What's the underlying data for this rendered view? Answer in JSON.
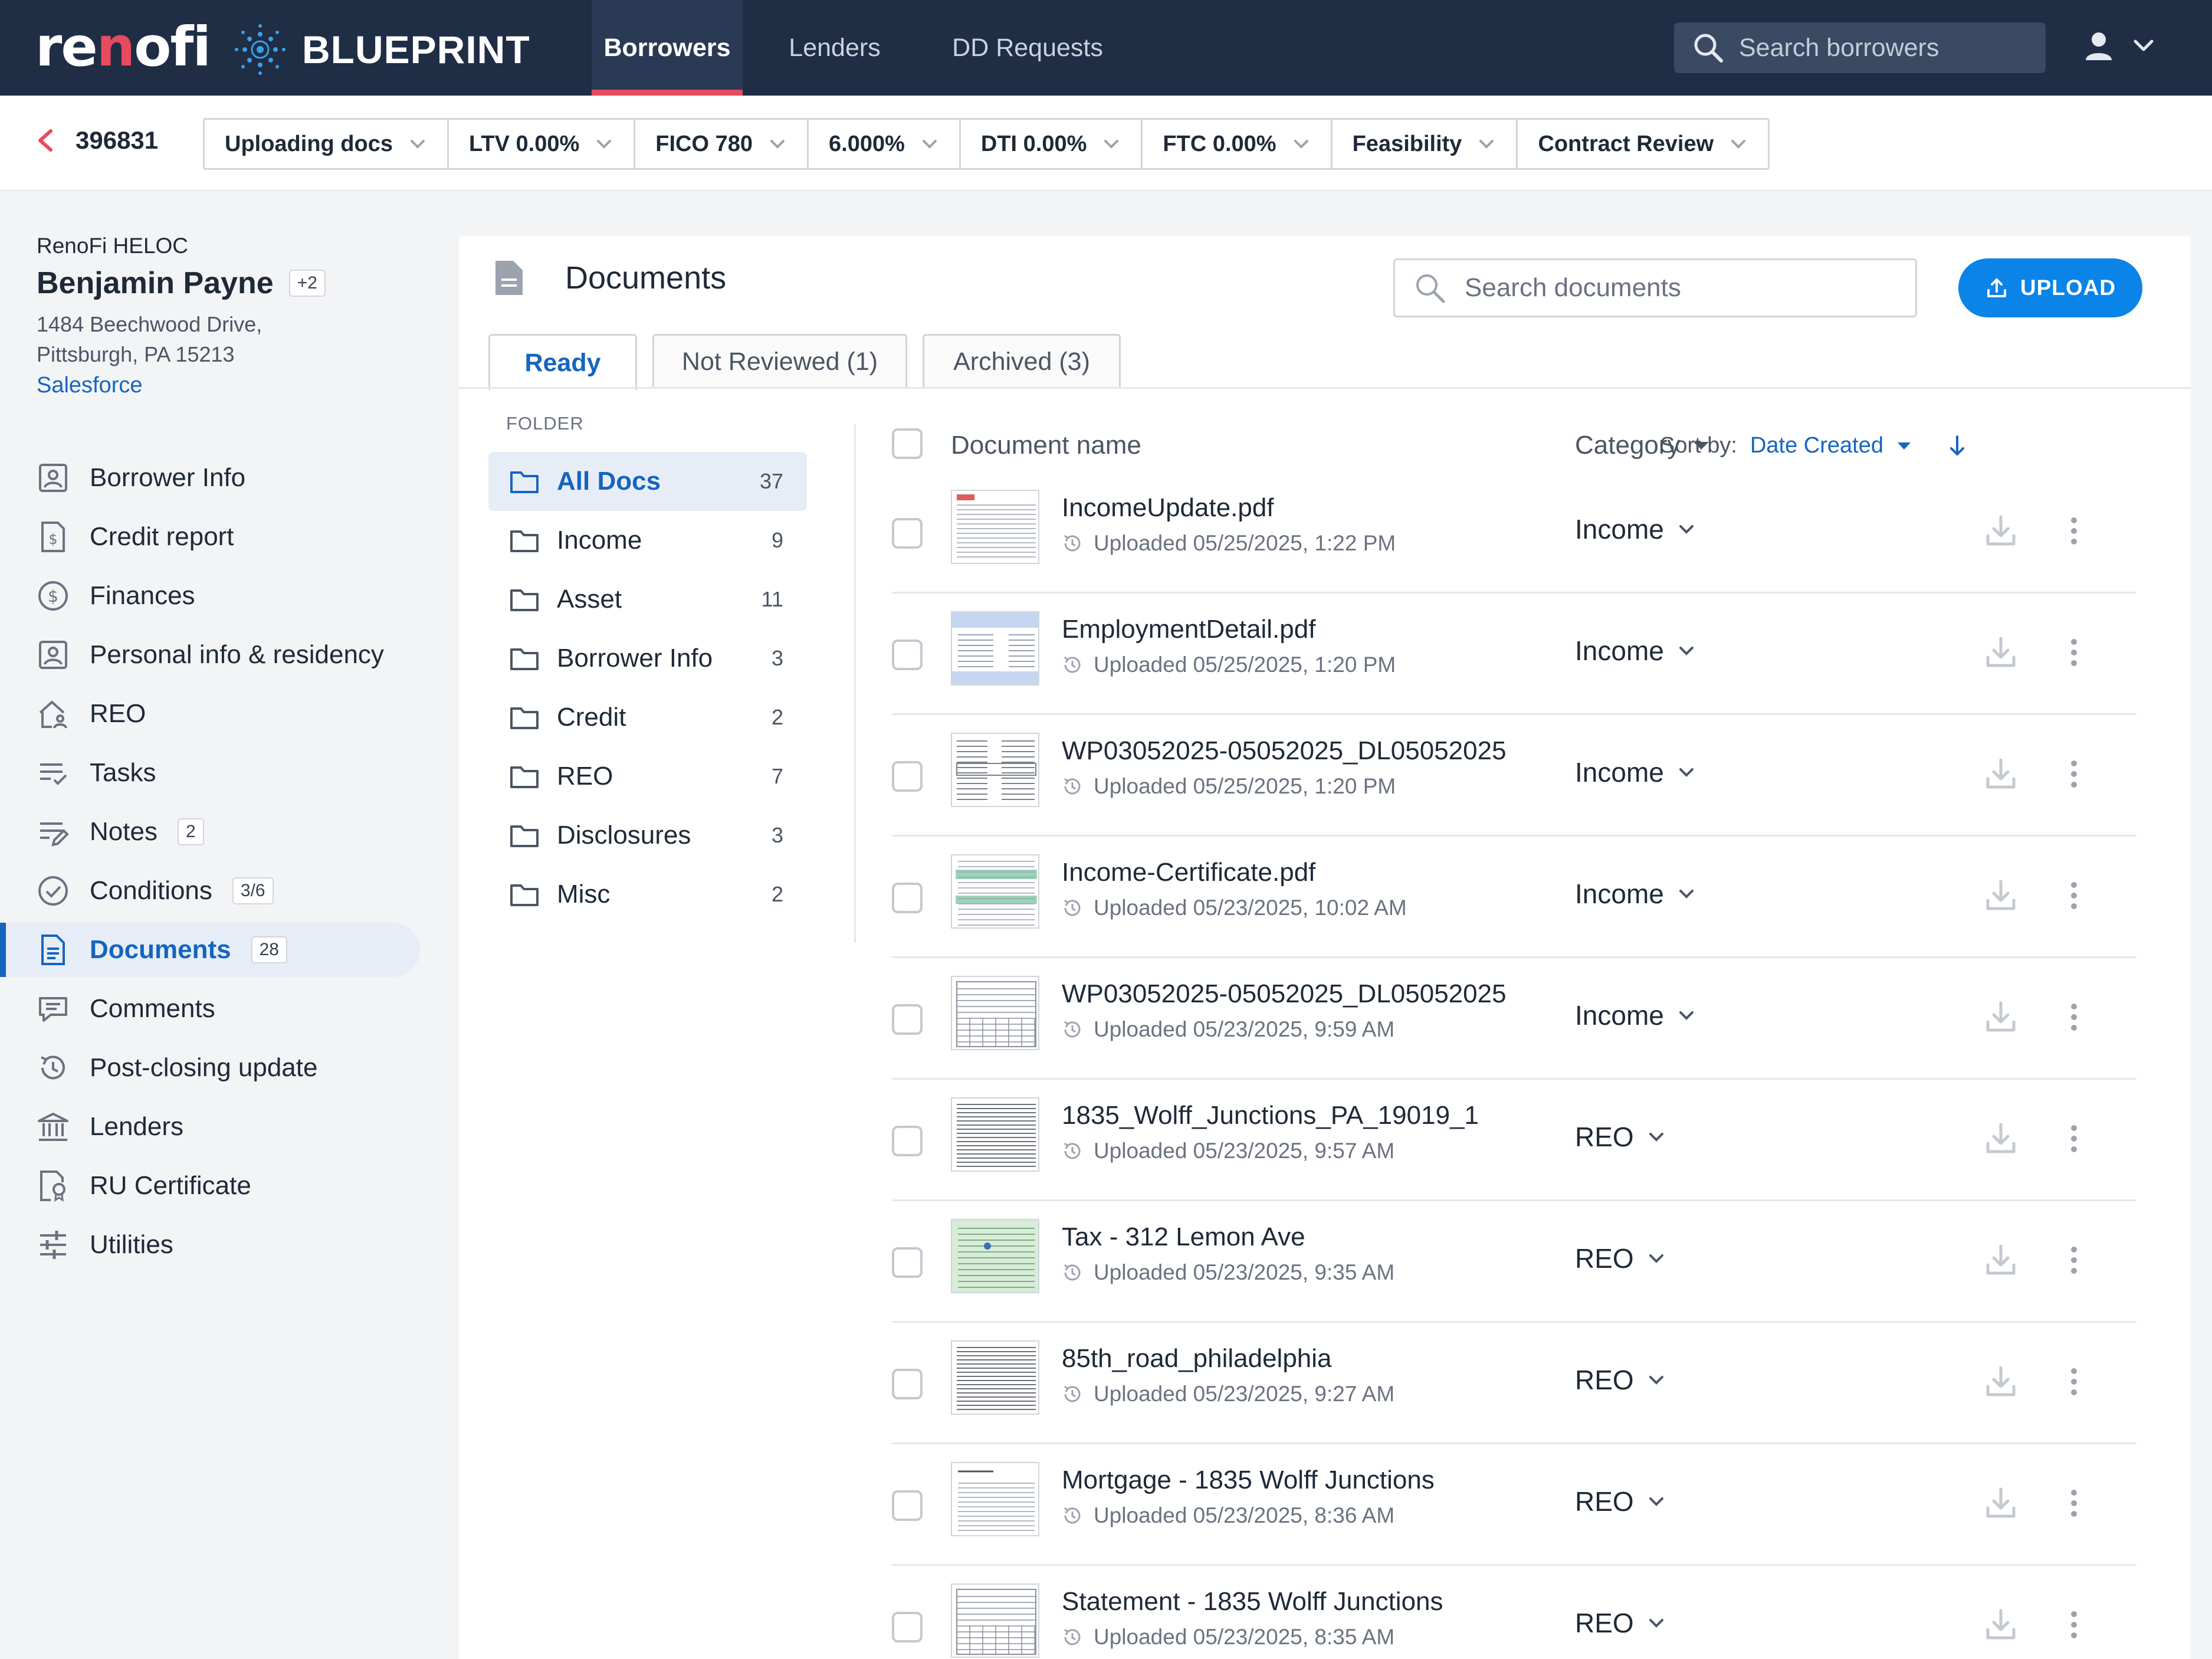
{
  "app": {
    "logo_text_pre": "re",
    "logo_text_accent": "n",
    "logo_text_post": "ofi",
    "product_name": "BLUEPRINT",
    "brand_color": "#1f2d45",
    "accent_color": "#e84a5f",
    "link_color": "#1565c0",
    "primary_button_color": "#0a84e8"
  },
  "topnav": {
    "tabs": [
      {
        "label": "Borrowers",
        "active": true
      },
      {
        "label": "Lenders",
        "active": false
      },
      {
        "label": "DD Requests",
        "active": false
      }
    ],
    "search_placeholder": "Search borrowers",
    "user_icon": "user-icon",
    "menu_icon": "chevron-down-icon"
  },
  "statusbar": {
    "loan_id": "396831",
    "pills": [
      {
        "label": "Uploading docs"
      },
      {
        "label": "LTV 0.00%"
      },
      {
        "label": "FICO 780"
      },
      {
        "label": "6.000%"
      },
      {
        "label": "DTI 0.00%"
      },
      {
        "label": "FTC 0.00%"
      },
      {
        "label": "Feasibility"
      },
      {
        "label": "Contract Review"
      }
    ]
  },
  "borrower": {
    "product": "RenoFi HELOC",
    "name": "Benjamin Payne",
    "extra": "+2",
    "address_line1": "1484 Beechwood Drive,",
    "address_line2": "Pittsburgh, PA 15213",
    "link": "Salesforce"
  },
  "sidebar": {
    "items": [
      {
        "label": "Borrower Info",
        "icon": "id-card-icon",
        "count": ""
      },
      {
        "label": "Credit report",
        "icon": "credit-report-icon",
        "count": ""
      },
      {
        "label": "Finances",
        "icon": "dollar-circle-icon",
        "count": ""
      },
      {
        "label": "Personal info & residency",
        "icon": "id-card-icon",
        "count": ""
      },
      {
        "label": "REO",
        "icon": "house-person-icon",
        "count": ""
      },
      {
        "label": "Tasks",
        "icon": "tasks-icon",
        "count": ""
      },
      {
        "label": "Notes",
        "icon": "notes-icon",
        "count": "2"
      },
      {
        "label": "Conditions",
        "icon": "check-circle-icon",
        "count": "3/6"
      },
      {
        "label": "Documents",
        "icon": "document-icon",
        "count": "28",
        "active": true
      },
      {
        "label": "Comments",
        "icon": "comment-icon",
        "count": ""
      },
      {
        "label": "Post-closing update",
        "icon": "history-icon",
        "count": ""
      },
      {
        "label": "Lenders",
        "icon": "bank-icon",
        "count": ""
      },
      {
        "label": "RU Certificate",
        "icon": "certificate-icon",
        "count": ""
      },
      {
        "label": "Utilities",
        "icon": "sliders-icon",
        "count": ""
      }
    ]
  },
  "documents": {
    "title": "Documents",
    "search_placeholder": "Search documents",
    "upload_label": "UPLOAD",
    "tabs": [
      {
        "label": "Ready",
        "active": true
      },
      {
        "label": "Not Reviewed (1)",
        "active": false
      },
      {
        "label": "Archived (3)",
        "active": false
      }
    ],
    "folder_label": "FOLDER",
    "folders": [
      {
        "name": "All Docs",
        "count": "37",
        "active": true
      },
      {
        "name": "Income",
        "count": "9"
      },
      {
        "name": "Asset",
        "count": "11"
      },
      {
        "name": "Borrower Info",
        "count": "3"
      },
      {
        "name": "Credit",
        "count": "2"
      },
      {
        "name": "REO",
        "count": "7"
      },
      {
        "name": "Disclosures",
        "count": "3"
      },
      {
        "name": "Misc",
        "count": "2"
      }
    ],
    "columns": {
      "name": "Document name",
      "category": "Category",
      "sort_label": "Sort by:",
      "sort_value": "Date Created"
    },
    "rows": [
      {
        "name": "IncomeUpdate.pdf",
        "uploaded": "Uploaded 05/25/2025, 1:22 PM",
        "category": "Income",
        "thumb": "form-red"
      },
      {
        "name": "EmploymentDetail.pdf",
        "uploaded": "Uploaded 05/25/2025, 1:20 PM",
        "category": "Income",
        "thumb": "form-blue"
      },
      {
        "name": "WP03052025-05052025_DL05052025",
        "uploaded": "Uploaded 05/25/2025, 1:20 PM",
        "category": "Income",
        "thumb": "stub"
      },
      {
        "name": "Income-Certificate.pdf",
        "uploaded": "Uploaded 05/23/2025, 10:02 AM",
        "category": "Income",
        "thumb": "form-green"
      },
      {
        "name": "WP03052025-05052025_DL05052025",
        "uploaded": "Uploaded 05/23/2025, 9:59 AM",
        "category": "Income",
        "thumb": "table"
      },
      {
        "name": "1835_Wolff_Junctions_PA_19019_1",
        "uploaded": "Uploaded 05/23/2025, 9:57 AM",
        "category": "REO",
        "thumb": "text"
      },
      {
        "name": "Tax - 312 Lemon Ave",
        "uploaded": "Uploaded 05/23/2025, 9:35 AM",
        "category": "REO",
        "thumb": "green"
      },
      {
        "name": "85th_road_philadelphia",
        "uploaded": "Uploaded 05/23/2025, 9:27 AM",
        "category": "REO",
        "thumb": "text"
      },
      {
        "name": "Mortgage - 1835 Wolff Junctions",
        "uploaded": "Uploaded 05/23/2025, 8:36 AM",
        "category": "REO",
        "thumb": "letter"
      },
      {
        "name": "Statement - 1835 Wolff Junctions",
        "uploaded": "Uploaded 05/23/2025, 8:35 AM",
        "category": "REO",
        "thumb": "table"
      }
    ]
  }
}
